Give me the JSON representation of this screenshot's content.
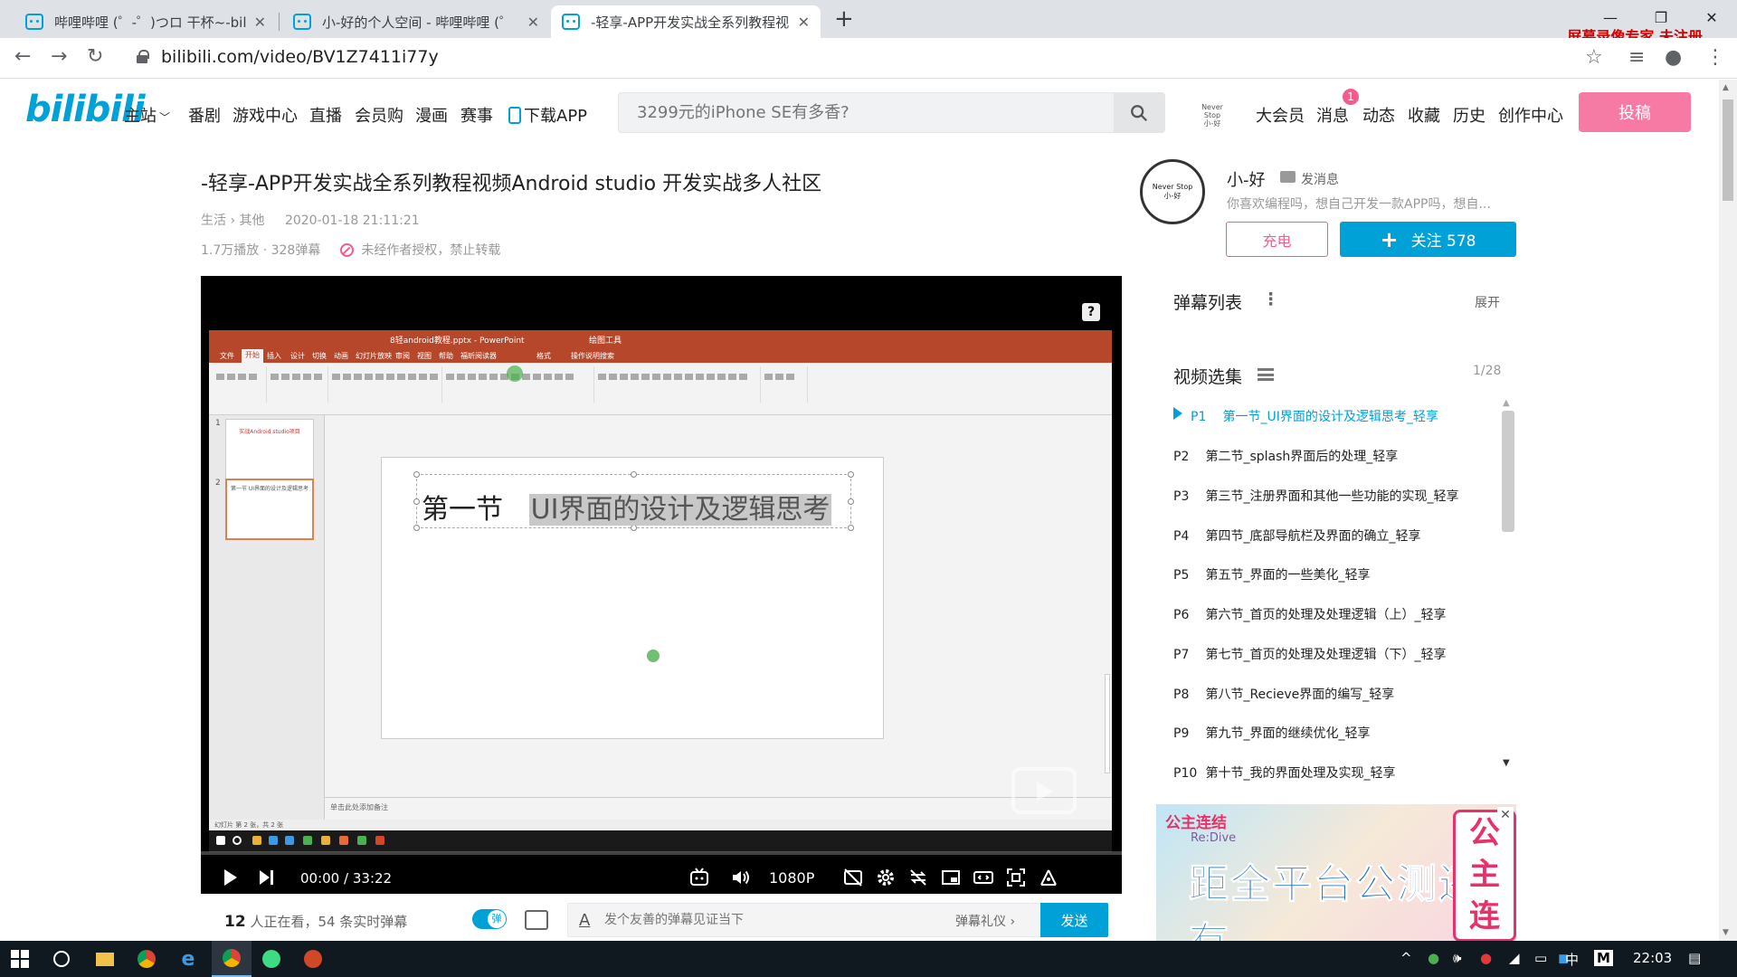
{
  "browser": {
    "tabs": [
      {
        "title": "哔哩哔哩 (゜-゜)つロ 干杯~-bili",
        "active": false
      },
      {
        "title": "小-好的个人空间 - 哔哩哔哩 (゜",
        "active": false
      },
      {
        "title": "-轻享-APP开发实战全系列教程视",
        "active": true
      }
    ],
    "new_tab": "+",
    "window_controls": {
      "minimize": "—",
      "maximize": "❐",
      "close": "✕"
    },
    "watermark": "屏幕录像专家  未注册",
    "url": "bilibili.com/video/BV1Z7411i77y",
    "icons": [
      "back-icon",
      "forward-icon",
      "reload-icon",
      "lock-icon",
      "star-icon",
      "media-icon",
      "profile-icon",
      "menu-icon"
    ]
  },
  "header": {
    "logo": "bilibili",
    "nav": [
      "主站",
      "番剧",
      "游戏中心",
      "直播",
      "会员购",
      "漫画",
      "赛事",
      "下载APP"
    ],
    "search_placeholder": "3299元的iPhone SE有多香?",
    "mini_avatar_text": [
      "Never Stop",
      "小-好"
    ],
    "user_nav": [
      "大会员",
      "消息",
      "动态",
      "收藏",
      "历史",
      "创作中心"
    ],
    "message_badge": "1",
    "post_button": "投稿"
  },
  "video": {
    "title": "-轻享-APP开发实战全系列教程视频Android studio 开发实战多人社区",
    "category": "生活 › 其他",
    "date": "2020-01-18 21:11:21",
    "stats": "1.7万播放 · 328弹幕",
    "copyright": "未经作者授权，禁止转载"
  },
  "player": {
    "ppt": {
      "window_title": "8轻android教程.pptx - PowerPoint",
      "drawing_tools": "绘图工具",
      "tabs": [
        "文件",
        "开始",
        "插入",
        "设计",
        "切换",
        "动画",
        "幻灯片放映",
        "审阅",
        "视图",
        "帮助",
        "福昕阅读器",
        "格式",
        "操作说明搜索"
      ],
      "slide_heading": "第一节",
      "slide_heading_highlight": "UI界面的设计及逻辑思考",
      "thumb1_text": "实战Android studio项目",
      "thumb2_text": "第一节 UI界面的设计及逻辑思考",
      "notes": "单击此处添加备注",
      "status": "幻灯片 第 2 张，共 2 张"
    },
    "progress": 0.0,
    "time_current": "00:00",
    "time_sep": "/",
    "time_total": "33:22",
    "quality": "1080P",
    "help": "?"
  },
  "below_player": {
    "viewers_count": "12",
    "viewers_text": " 人正在看，",
    "danmaku_loaded": "54 条实时弹幕",
    "danmaku_placeholder": "发个友善的弹幕见证当下",
    "etiquette": "弹幕礼仪 ›",
    "send": "发送"
  },
  "uploader": {
    "name": "小-好",
    "message": "发消息",
    "avatar_text": [
      "Never Stop",
      "小-好"
    ],
    "description": "你喜欢编程吗，想自己开发一款APP吗，想自...",
    "charge": "充电",
    "follow": "关注 578"
  },
  "danmu_list": {
    "title": "弹幕列表",
    "more": "⋮",
    "expand": "展开"
  },
  "episodes": {
    "title": "视频选集",
    "count": "1/28",
    "items": [
      {
        "p": "P1",
        "title": "第一节_UI界面的设计及逻辑思考_轻享"
      },
      {
        "p": "P2",
        "title": "第二节_splash界面后的处理_轻享"
      },
      {
        "p": "P3",
        "title": "第三节_注册界面和其他一些功能的实现_轻享"
      },
      {
        "p": "P4",
        "title": "第四节_底部导航栏及界面的确立_轻享"
      },
      {
        "p": "P5",
        "title": "第五节_界面的一些美化_轻享"
      },
      {
        "p": "P6",
        "title": "第六节_首页的处理及处理逻辑（上）_轻享"
      },
      {
        "p": "P7",
        "title": "第七节_首页的处理及处理逻辑（下）_轻享"
      },
      {
        "p": "P8",
        "title": "第八节_Recieve界面的编写_轻享"
      },
      {
        "p": "P9",
        "title": "第九节_界面的继续优化_轻享"
      },
      {
        "p": "P10",
        "title": "第十节_我的界面处理及实现_轻享"
      }
    ]
  },
  "ad": {
    "logo": "公主连结",
    "logo_sub": "Re:Dive",
    "text": "距全平台公测还有",
    "badge": "公主连"
  },
  "taskbar": {
    "time": "22:03",
    "ime": "中",
    "tray_m": "M"
  }
}
